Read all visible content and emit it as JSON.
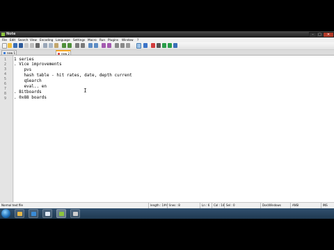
{
  "window": {
    "title": "Note",
    "min": "–",
    "max": "□",
    "close": "✕"
  },
  "menu": [
    "File",
    "Edit",
    "Search",
    "View",
    "Encoding",
    "Language",
    "Settings",
    "Macro",
    "Run",
    "Plugins",
    "Window",
    "?"
  ],
  "tabs": [
    {
      "label": "new 1"
    },
    {
      "label": "new 2"
    }
  ],
  "gutter_labels": [
    "1",
    "2",
    "3",
    "4",
    "5",
    "6",
    "7",
    "8",
    "9"
  ],
  "editor": {
    "lines": [
      "1 series",
      ". Vice improvements",
      "    pvs",
      "    hash table - hit rates, date, depth current",
      "    qSearch",
      "    eval.. en",
      ". Bitboards",
      ". 0x88 boards"
    ],
    "cursor_glyph": "I"
  },
  "status": {
    "file_type": "Normal text file",
    "length": "length : 1##",
    "lines": "lines : 8",
    "position": "Ln : 6",
    "column": "Col : 14",
    "selection": "Sel : 0",
    "eol": "Dos\\Windows",
    "encoding": "ANSI",
    "mode": "INS"
  },
  "taskbar": {
    "items": [
      "explorer",
      "media",
      "notepad",
      "notepad++",
      "doc"
    ]
  },
  "colors": {
    "accent": "#3a7bd5",
    "tab_active_top": "#f5a623",
    "taskbar": "#203a52",
    "gutter": "#e4e4e4"
  }
}
